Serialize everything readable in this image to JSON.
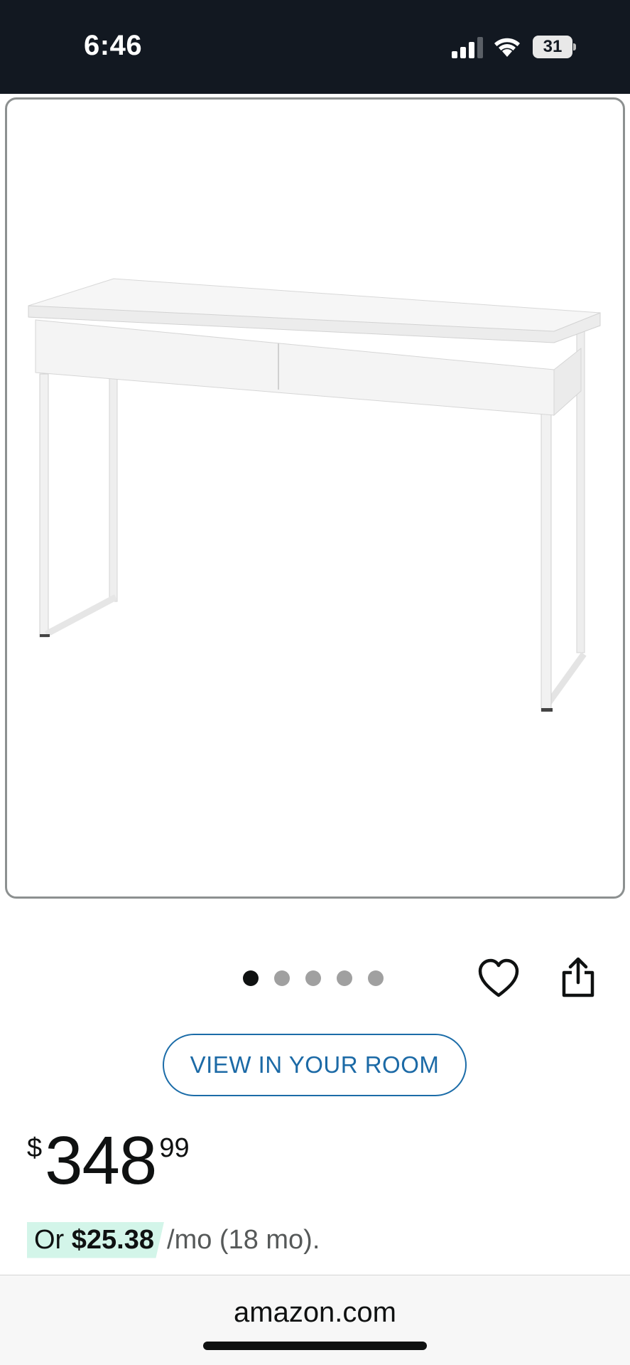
{
  "status_bar": {
    "time": "6:46",
    "battery": "31",
    "signal_icon": "cellular-signal-icon",
    "wifi_icon": "wifi-icon",
    "battery_icon": "battery-icon"
  },
  "product": {
    "image_description_icon": "white-desk-two-drawers-image",
    "carousel": {
      "total": 5,
      "active_index": 0
    },
    "wishlist_icon": "heart-outline-icon",
    "share_icon": "share-icon",
    "view_in_room_label": "VIEW IN YOUR ROOM",
    "price": {
      "symbol": "$",
      "whole": "348",
      "fraction": "99"
    },
    "installment": {
      "prefix": "Or ",
      "amount": "$25.38",
      "suffix": "/mo (18 mo)."
    }
  },
  "browser": {
    "url": "amazon.com"
  },
  "colors": {
    "status_bar_bg": "#121821",
    "button_blue": "#1c6aa6",
    "installment_highlight": "#d3f5e9",
    "dot_active": "#0f1111",
    "dot_inactive": "#a0a0a0"
  }
}
